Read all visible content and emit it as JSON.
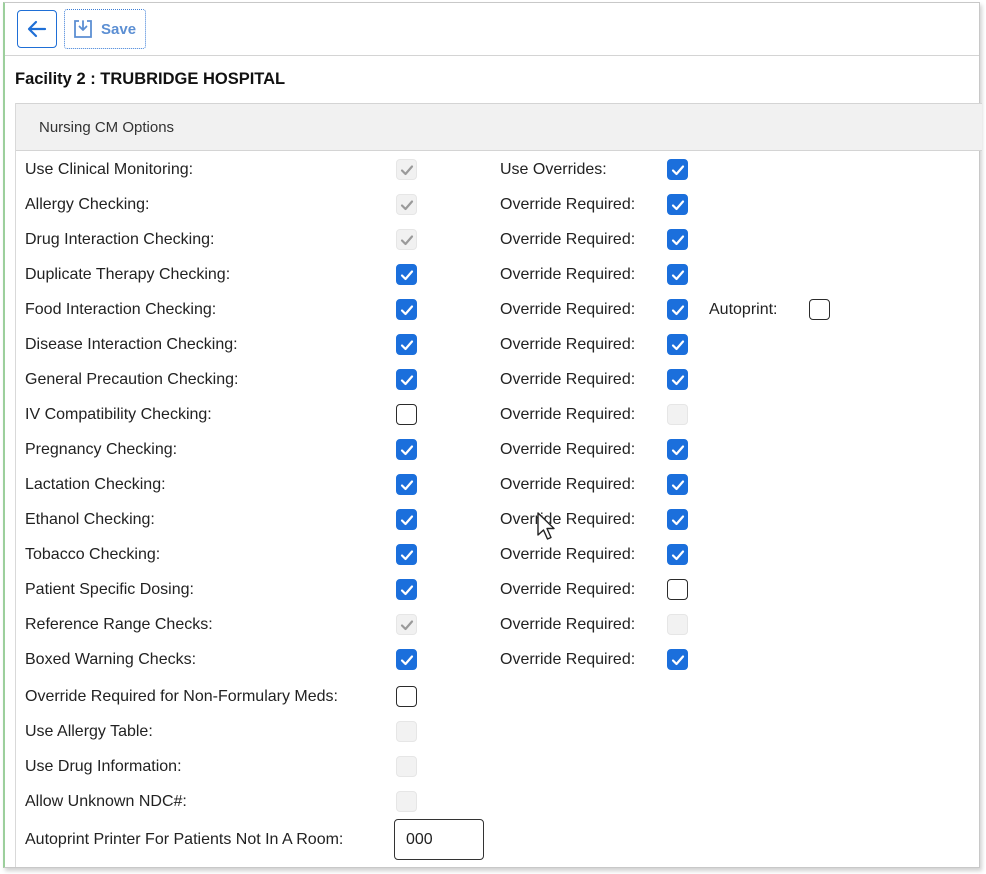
{
  "toolbar": {
    "save_label": "Save",
    "back_icon": "arrow-left-icon",
    "save_icon": "save-icon"
  },
  "page": {
    "title": "Facility 2 : TRUBRIDGE HOSPITAL"
  },
  "section": {
    "title": "Nursing CM Options"
  },
  "colors": {
    "accent": "#1b6fdc",
    "header_bg": "#f1f1f1"
  },
  "options": [
    {
      "label": "Use Clinical Monitoring:",
      "state": "disabled-checked",
      "right_label": "Use Overrides:",
      "right_state": "checked"
    },
    {
      "label": "Allergy Checking:",
      "state": "disabled-checked",
      "right_label": "Override Required:",
      "right_state": "checked"
    },
    {
      "label": "Drug Interaction Checking:",
      "state": "disabled-checked",
      "right_label": "Override Required:",
      "right_state": "checked"
    },
    {
      "label": "Duplicate Therapy Checking:",
      "state": "checked",
      "right_label": "Override Required:",
      "right_state": "checked"
    },
    {
      "label": "Food Interaction Checking:",
      "state": "checked",
      "right_label": "Override Required:",
      "right_state": "checked",
      "extra_label": "Autoprint:",
      "extra_state": "unchecked"
    },
    {
      "label": "Disease Interaction Checking:",
      "state": "checked",
      "right_label": "Override Required:",
      "right_state": "checked"
    },
    {
      "label": "General Precaution Checking:",
      "state": "checked",
      "right_label": "Override Required:",
      "right_state": "checked"
    },
    {
      "label": "IV Compatibility Checking:",
      "state": "unchecked",
      "right_label": "Override Required:",
      "right_state": "disabled-unchecked"
    },
    {
      "label": "Pregnancy Checking:",
      "state": "checked",
      "right_label": "Override Required:",
      "right_state": "checked"
    },
    {
      "label": "Lactation Checking:",
      "state": "checked",
      "right_label": "Override Required:",
      "right_state": "checked"
    },
    {
      "label": "Ethanol Checking:",
      "state": "checked",
      "right_label": "Override Required:",
      "right_state": "checked"
    },
    {
      "label": "Tobacco Checking:",
      "state": "checked",
      "right_label": "Override Required:",
      "right_state": "checked"
    },
    {
      "label": "Patient Specific Dosing:",
      "state": "checked",
      "right_label": "Override Required:",
      "right_state": "unchecked"
    },
    {
      "label": "Reference Range Checks:",
      "state": "disabled-checked",
      "right_label": "Override Required:",
      "right_state": "disabled-unchecked"
    },
    {
      "label": "Boxed Warning Checks:",
      "state": "checked",
      "right_label": "Override Required:",
      "right_state": "checked"
    }
  ],
  "more_options": [
    {
      "label": "Override Required for Non-Formulary Meds:",
      "state": "unchecked"
    },
    {
      "label": "Use Allergy Table:",
      "state": "disabled-unchecked"
    },
    {
      "label": "Use Drug Information:",
      "state": "disabled-unchecked"
    },
    {
      "label": "Allow Unknown NDC#:",
      "state": "disabled-unchecked"
    }
  ],
  "printer": {
    "label": "Autoprint Printer For Patients Not In A Room:",
    "value": "000"
  }
}
